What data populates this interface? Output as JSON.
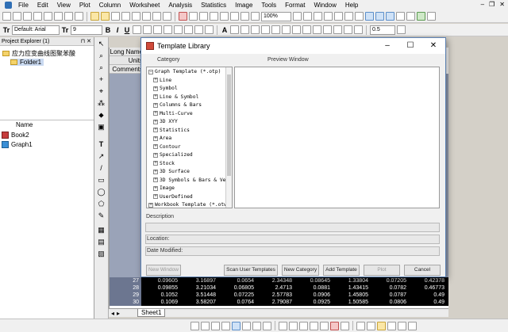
{
  "menubar": {
    "items": [
      "File",
      "Edit",
      "View",
      "Plot",
      "Column",
      "Worksheet",
      "Analysis",
      "Statistics",
      "Image",
      "Tools",
      "Format",
      "Window",
      "Help"
    ]
  },
  "toolbar": {
    "zoom": "100%",
    "font_name": "Default: Arial",
    "font_size": "9",
    "bold": "B",
    "italic": "I",
    "underline": "U",
    "line_width": "0.5"
  },
  "project_explorer": {
    "title": "Project Explorer (1)",
    "root_folder": "应力应变曲线图聚苯酸",
    "subfolder": "Folder1",
    "column_name": "Name",
    "items": [
      {
        "name": "Book2",
        "icon": "book-icon"
      },
      {
        "name": "Graph1",
        "icon": "graph-icon"
      }
    ]
  },
  "worksheet": {
    "header_labels": [
      "Long Name",
      "Units",
      "Comments"
    ],
    "rows": [
      {
        "n": "27",
        "cells": [
          "0.09605",
          "3.16897",
          "0.0654",
          "2.34348",
          "0.08645",
          "1.33804",
          "0.07205",
          "0.42378"
        ]
      },
      {
        "n": "28",
        "cells": [
          "0.09855",
          "3.21034",
          "0.06805",
          "2.4713",
          "0.0881",
          "1.43415",
          "0.0782",
          "0.46773"
        ]
      },
      {
        "n": "29",
        "cells": [
          "0.1052",
          "3.51448",
          "0.07225",
          "2.57783",
          "0.0906",
          "1.45805",
          "0.0787",
          "0.49"
        ]
      },
      {
        "n": "30",
        "cells": [
          "0.1069",
          "3.58207",
          "0.0764",
          "2.79087",
          "0.0925",
          "1.50585",
          "0.0806",
          "0.49"
        ]
      }
    ],
    "sheet_tab": "Sheet1"
  },
  "dialog": {
    "title": "Template Library",
    "category_label": "Category",
    "preview_label": "Preview Window",
    "root_item": "Graph Template (*.otp)",
    "categories": [
      "Line",
      "Symbol",
      "Line & Symbol",
      "Columns & Bars",
      "Multi-Curve",
      "3D XYY",
      "Statistics",
      "Area",
      "Contour",
      "Specialized",
      "Stock",
      "3D Surface",
      "3D Symbols & Bars & Ve",
      "Image",
      "UserDefined"
    ],
    "workbook_item": "Workbook Template (*.otw",
    "description_label": "Description",
    "location_label": "Location:",
    "date_label": "Date Modified:",
    "buttons": {
      "new_window": "New Window",
      "scan_user": "Scan User Templates",
      "new_category": "New Category",
      "add_template": "Add Template",
      "plot": "Plot",
      "cancel": "Cancel"
    }
  },
  "colors": {
    "row_header_fill": "#9aa3b8",
    "dialog_border": "#5a7fb0"
  }
}
